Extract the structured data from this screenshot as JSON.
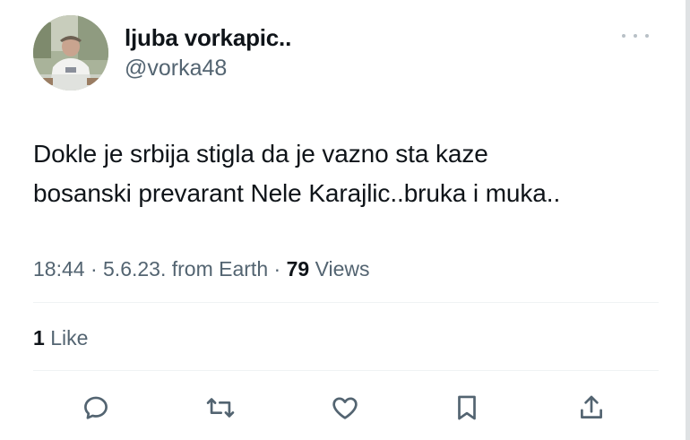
{
  "author": {
    "display_name": "ljuba vorkapic..",
    "handle": "@vorka48"
  },
  "tweet": {
    "text": "Dokle je srbija stigla da je vazno sta kaze\nbosanski prevarant Nele Karajlic..bruka i muka..",
    "time": "18:44",
    "date": "5.6.23.",
    "source": "from Earth",
    "views_count": "79",
    "views_label": "Views",
    "likes_count": "1",
    "likes_label": "Like"
  },
  "actions": [
    "reply-icon",
    "retweet-icon",
    "like-icon",
    "bookmark-icon",
    "share-icon"
  ],
  "colors": {
    "text": "#0f1419",
    "secondary": "#536471",
    "icon": "#536471",
    "divider": "#eff3f4"
  }
}
